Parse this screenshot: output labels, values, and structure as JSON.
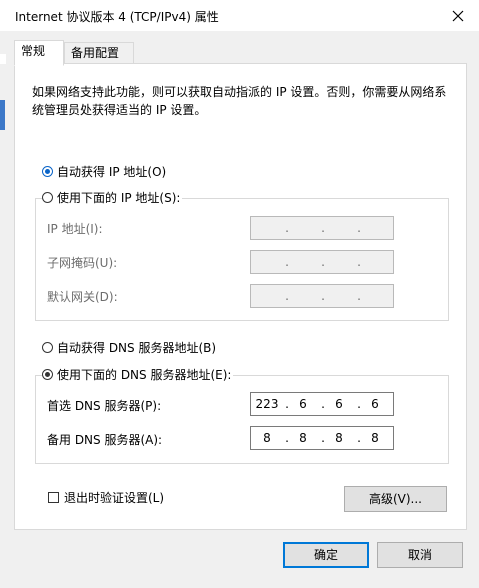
{
  "window": {
    "title": "Internet 协议版本 4 (TCP/IPv4) 属性"
  },
  "tabs": [
    {
      "label": "常规"
    },
    {
      "label": "备用配置"
    }
  ],
  "description": "如果网络支持此功能，则可以获取自动指派的 IP 设置。否则，你需要从网络系统管理员处获得适当的 IP 设置。",
  "ip": {
    "auto_label": "自动获得 IP 地址(O)",
    "manual_label": "使用下面的 IP 地址(S):",
    "auto_selected": true,
    "address_label": "IP 地址(I):",
    "mask_label": "子网掩码(U):",
    "gateway_label": "默认网关(D):"
  },
  "dns": {
    "auto_label": "自动获得 DNS 服务器地址(B)",
    "manual_label": "使用下面的 DNS 服务器地址(E):",
    "manual_selected": true,
    "preferred_label": "首选 DNS 服务器(P):",
    "alternate_label": "备用 DNS 服务器(A):",
    "preferred": [
      "223",
      "6",
      "6",
      "6"
    ],
    "alternate": [
      "8",
      "8",
      "8",
      "8"
    ]
  },
  "validate_label": "退出时验证设置(L)",
  "advanced_label": "高级(V)...",
  "ok_label": "确定",
  "cancel_label": "取消",
  "ip_dot": "."
}
